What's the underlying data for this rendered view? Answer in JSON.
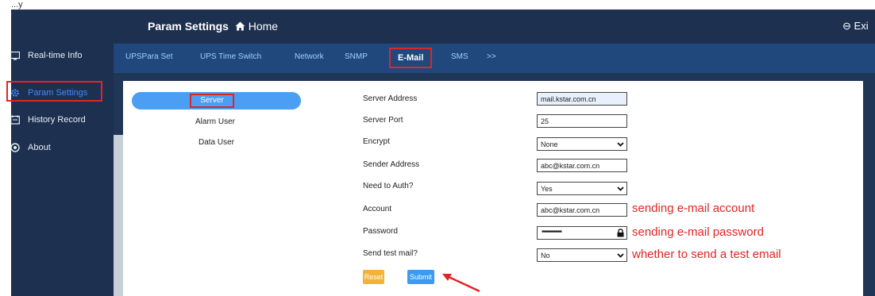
{
  "top_fragment": "...y",
  "header": {
    "title": "Param Settings",
    "home": "Home",
    "exit": "Exi"
  },
  "sidebar": {
    "items": [
      {
        "label": "Real-time Info",
        "icon": "monitor-icon"
      },
      {
        "label": "Param Settings",
        "icon": "gear-icon",
        "active": true
      },
      {
        "label": "History Record",
        "icon": "history-icon"
      },
      {
        "label": "About",
        "icon": "info-icon"
      }
    ]
  },
  "tabs": [
    {
      "label": "UPSPara Set"
    },
    {
      "label": "UPS Time Switch"
    },
    {
      "label": "Network"
    },
    {
      "label": "SNMP"
    },
    {
      "label": "E-Mail",
      "active": true
    },
    {
      "label": "SMS"
    },
    {
      "label": ">>"
    }
  ],
  "submenu": {
    "server": "Server",
    "alarm_user": "Alarm User",
    "data_user": "Data User"
  },
  "form": {
    "server_address": {
      "label": "Server Address",
      "value": "mail.kstar.com.cn"
    },
    "server_port": {
      "label": "Server Port",
      "value": "25"
    },
    "encrypt": {
      "label": "Encrypt",
      "value": "None"
    },
    "sender_address": {
      "label": "Sender Address",
      "value": "abc@kstar.com.cn"
    },
    "need_auth": {
      "label": "Need to Auth?",
      "value": "Yes"
    },
    "account": {
      "label": "Account",
      "value": "abc@kstar.com.cn"
    },
    "password": {
      "label": "Password",
      "value": "••••••••••"
    },
    "send_test": {
      "label": "Send test mail?",
      "value": "No"
    }
  },
  "buttons": {
    "reset": "Reset",
    "submit": "Submit"
  },
  "annotations": {
    "account": "sending e-mail account",
    "password": "sending e-mail password",
    "send_test": "whether to send a test email"
  },
  "colors": {
    "sidebar_bg": "#1e3050",
    "tab_bar_bg": "#21487d",
    "accent_blue": "#3d8bff",
    "highlight_red": "#e02525",
    "reset_btn": "#f3b338",
    "submit_btn": "#3b9bf0"
  }
}
